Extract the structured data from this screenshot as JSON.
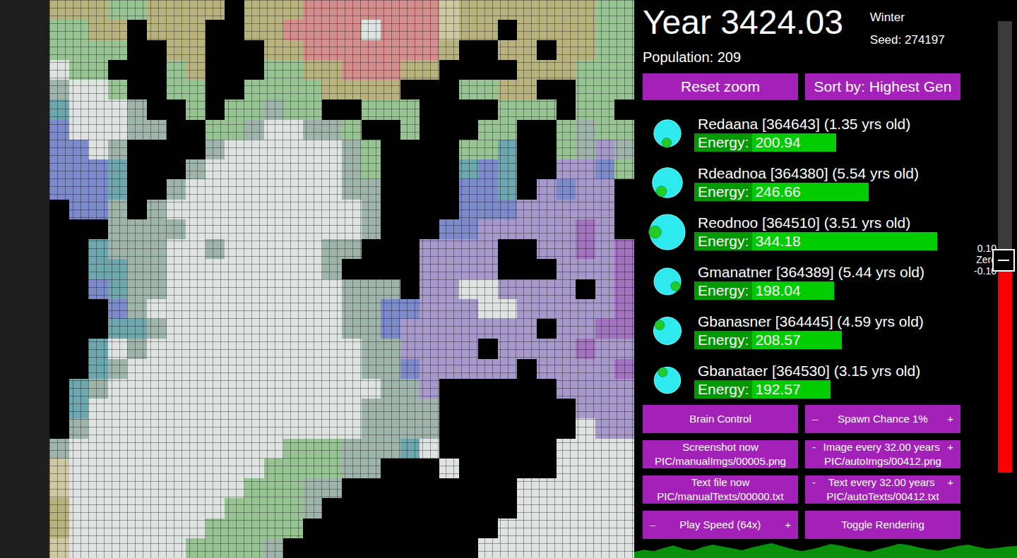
{
  "header": {
    "year": "Year 3424.03",
    "season": "Winter",
    "seed": "Seed: 274197",
    "population": "Population: 209"
  },
  "top_buttons": [
    "Reset zoom",
    "Sort by: Highest Gen"
  ],
  "creatures": [
    {
      "name": "Redaana [364643] (1.35 yrs old)",
      "energy_label": "Energy:",
      "energy": "200.94",
      "level": 0.574,
      "facing": 95
    },
    {
      "name": "Rdeadnoa [364380] (5.54 yrs old)",
      "energy_label": "Energy:",
      "energy": "246.66",
      "level": 0.705,
      "facing": 125
    },
    {
      "name": "Reodnoo [364510] (3.51 yrs old)",
      "energy_label": "Energy:",
      "energy": "344.18",
      "level": 0.983,
      "facing": 180
    },
    {
      "name": "Gmanatner [364389] (5.44 yrs old)",
      "energy_label": "Energy:",
      "energy": "198.04",
      "level": 0.566,
      "facing": 30
    },
    {
      "name": "Gbanasner [364445] (4.59 yrs old)",
      "energy_label": "Energy:",
      "energy": "208.57",
      "level": 0.596,
      "facing": 217
    },
    {
      "name": "Gbanataer [364530] (3.15 yrs old)",
      "energy_label": "Energy:",
      "energy": "192.57",
      "level": 0.55,
      "facing": 240
    }
  ],
  "controls": [
    {
      "kind": "button",
      "lines": [
        "Brain Control"
      ]
    },
    {
      "kind": "stepper",
      "lines": [
        "Spawn Chance 1%"
      ],
      "minus": "–",
      "plus": "+"
    },
    {
      "kind": "button",
      "lines": [
        "Screenshot now",
        "PIC/manualImgs/00005.png"
      ]
    },
    {
      "kind": "stepper",
      "lines": [
        "Image every 32.00 years",
        "PIC/autoImgs/00412.png"
      ],
      "minus": "-",
      "plus": "+"
    },
    {
      "kind": "button",
      "lines": [
        "Text file now",
        "PIC/manualTexts/00000.txt"
      ]
    },
    {
      "kind": "stepper",
      "lines": [
        "Text every 32.00 years",
        "PIC/autoTexts/00412.txt"
      ],
      "minus": "-",
      "plus": "+"
    },
    {
      "kind": "stepper",
      "lines": [
        "Play Speed (64x)"
      ],
      "minus": "–",
      "plus": "+"
    },
    {
      "kind": "button",
      "lines": [
        "Toggle Rendering"
      ]
    }
  ],
  "slider": {
    "top_label": "0.10",
    "mid_label": "Zero",
    "bottom_label": "-0.10",
    "level": 0.47
  },
  "population_history": [
    196,
    201,
    198,
    205,
    210,
    203,
    199,
    207,
    212,
    208,
    204,
    200,
    206,
    211,
    215,
    209,
    203,
    198,
    202,
    207,
    213,
    210,
    205,
    201,
    197,
    203,
    208,
    214,
    211,
    206,
    202,
    199,
    204,
    209,
    212,
    207,
    203,
    205,
    208,
    209
  ],
  "terrain": {
    "palette": {
      "k": "#000000",
      "w": "#dfe4e2",
      "s": "#9fb5ab",
      "g": "#98c494",
      "y": "#b8b27e",
      "r": "#d58e8e",
      "c": "#cfc9a3",
      "t": "#6fa7ae",
      "b": "#7d8bcb",
      "p": "#a79acb",
      "m": "#a274c0"
    },
    "rows": [
      "yyyggyyyykyyyrrrrrrrcyyyyyyygg",
      "ggyykyyykkyyrrrrwrrrcyykyyyygg",
      "ggggkkyykkkyyrrrrrrrykkyykyygg",
      "wggkkkgykkkggyyrrryykkkkyyyggg",
      "swwgkkggkkggggyyyykkkggyykkggg",
      "twwwskkgkggsggkkgggkkkkgggkggk",
      "bwwwsskkggswwssgkkgkkkggkkgsgg",
      "bbwskkkkswwwwwwsgkkkkggtkkgsps",
      "bbbtkkkswwwwwwwsgkkkktbtkkppbg",
      "bbbtkkswwwwwwwwsskkkkbbtkpbppk",
      "kbbskswwwwwwwwwwskkkkbbbpppppk",
      "kkksssswwwwwwwwwskkkbbpppppmpk",
      "kktssswwswwwwwsskkkppppkkppmpm",
      "kkttsswwwwwwwwskkkkppppkkkpppm",
      "kkbtsswwwwwwwwwssskppwwppppkpm",
      "kkkbswwwwwwwwwwssbbpppwwpppppm",
      "kkkttswwwwwwwwwssbpppppppkppmm",
      "kktwswwwwwwwwwwwssppppkppppmpp",
      "kktswwwwwwwwwwwwssbpppppkppppm",
      "ktswwwwwwwwwwwwwwsspkkkkkkpppp",
      "ktwwwwwwwwwwwwwwsssskkkkkkkppp",
      "kswwwwwwwwwwwwwwsssskkkkkkkwpp",
      "swwwwwwwwwwwgggssstwkkkkkkwwww",
      "cwwwwwwwwwwggggsskkkwkkkkkwwww",
      "cwwwwwwwwwgggsskkkkkkkkkwwwwww",
      "ywwwwwwwwggggskkkkkkkkkkwwwwwww",
      "ywwwwwwwgggggkkkkkkkkkkwwwwwwww",
      "cwwwwwwggggskkkkkkkkkkwwwwwwwww"
    ]
  }
}
